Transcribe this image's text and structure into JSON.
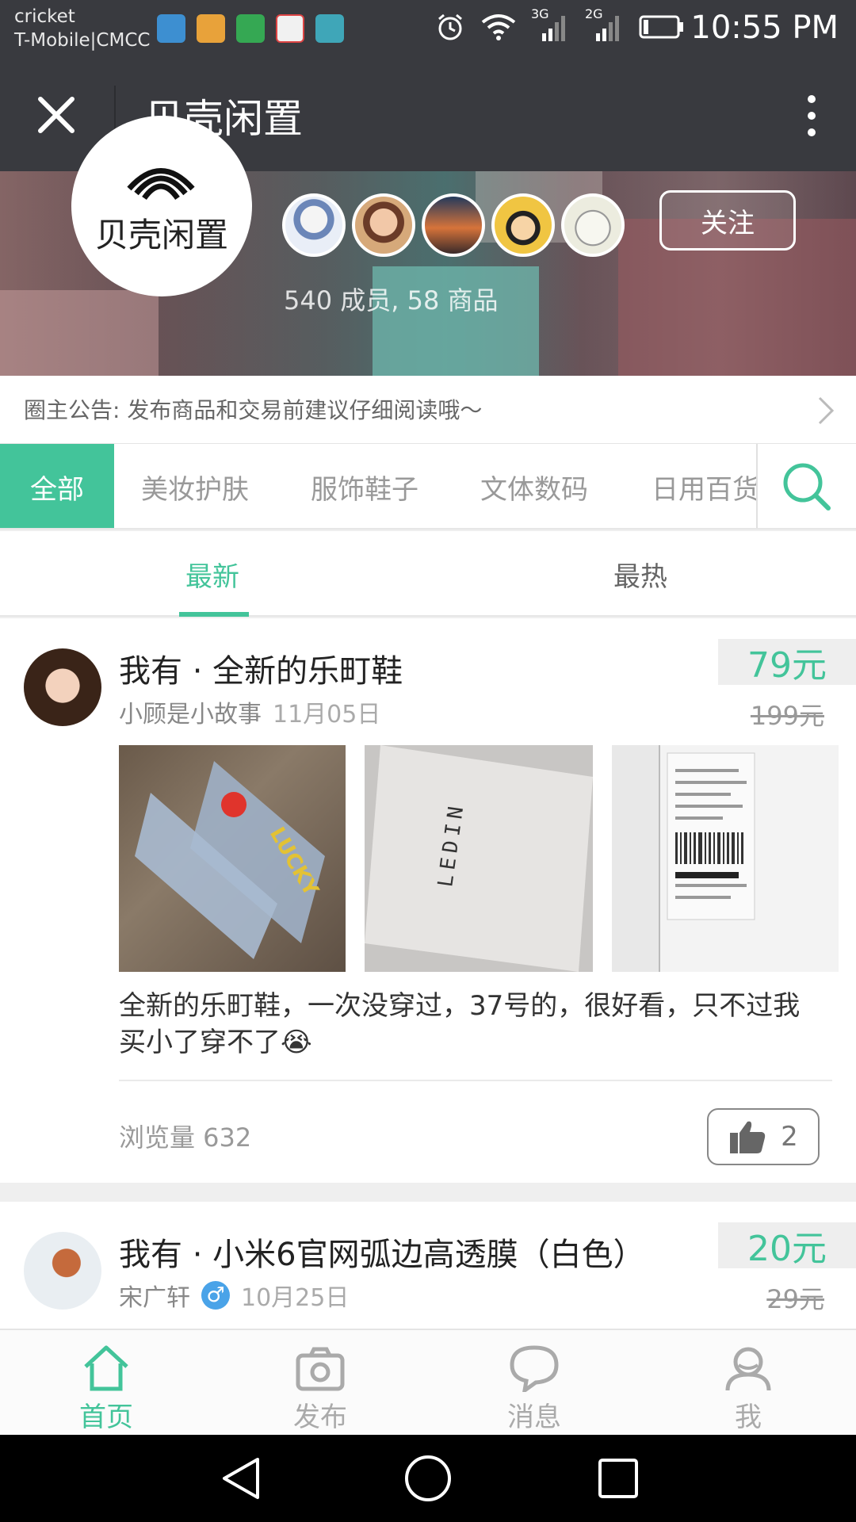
{
  "status_bar": {
    "carrier_line1": "cricket",
    "carrier_line2": "T-Mobile|CMCC",
    "net1": "3G",
    "net2": "2G",
    "time": "10:55 PM"
  },
  "title_bar": {
    "title": "贝壳闲置",
    "close_icon": "close-icon",
    "more_icon": "more-vertical-icon"
  },
  "group": {
    "logo_text": "贝壳闲置",
    "stats": "540 成员, 58 商品",
    "follow_label": "关注"
  },
  "announcement": {
    "text": "圈主公告: 发布商品和交易前建议仔细阅读哦～"
  },
  "categories": [
    "全部",
    "美妆护肤",
    "服饰鞋子",
    "文体数码",
    "日用百货"
  ],
  "sort_tabs": [
    "最新",
    "最热"
  ],
  "posts": [
    {
      "title": "我有 · 全新的乐町鞋",
      "author": "小顾是小故事",
      "date": "11月05日",
      "price": "79元",
      "old_price": "199元",
      "description": "全新的乐町鞋，一次没穿过，37号的，很好看，只不过我买小了穿不了😭",
      "views": "浏览量 632",
      "likes": "2"
    },
    {
      "title": "我有 · 小米6官网弧边高透膜（白色）",
      "author": "宋广轩",
      "gender": "♂",
      "date": "10月25日",
      "price": "20元",
      "old_price": "29元"
    }
  ],
  "bottom_nav": [
    "首页",
    "发布",
    "消息",
    "我"
  ],
  "colors": {
    "accent": "#43c49a",
    "titlebar": "#393a3f",
    "gender_male": "#4aa3e8"
  }
}
